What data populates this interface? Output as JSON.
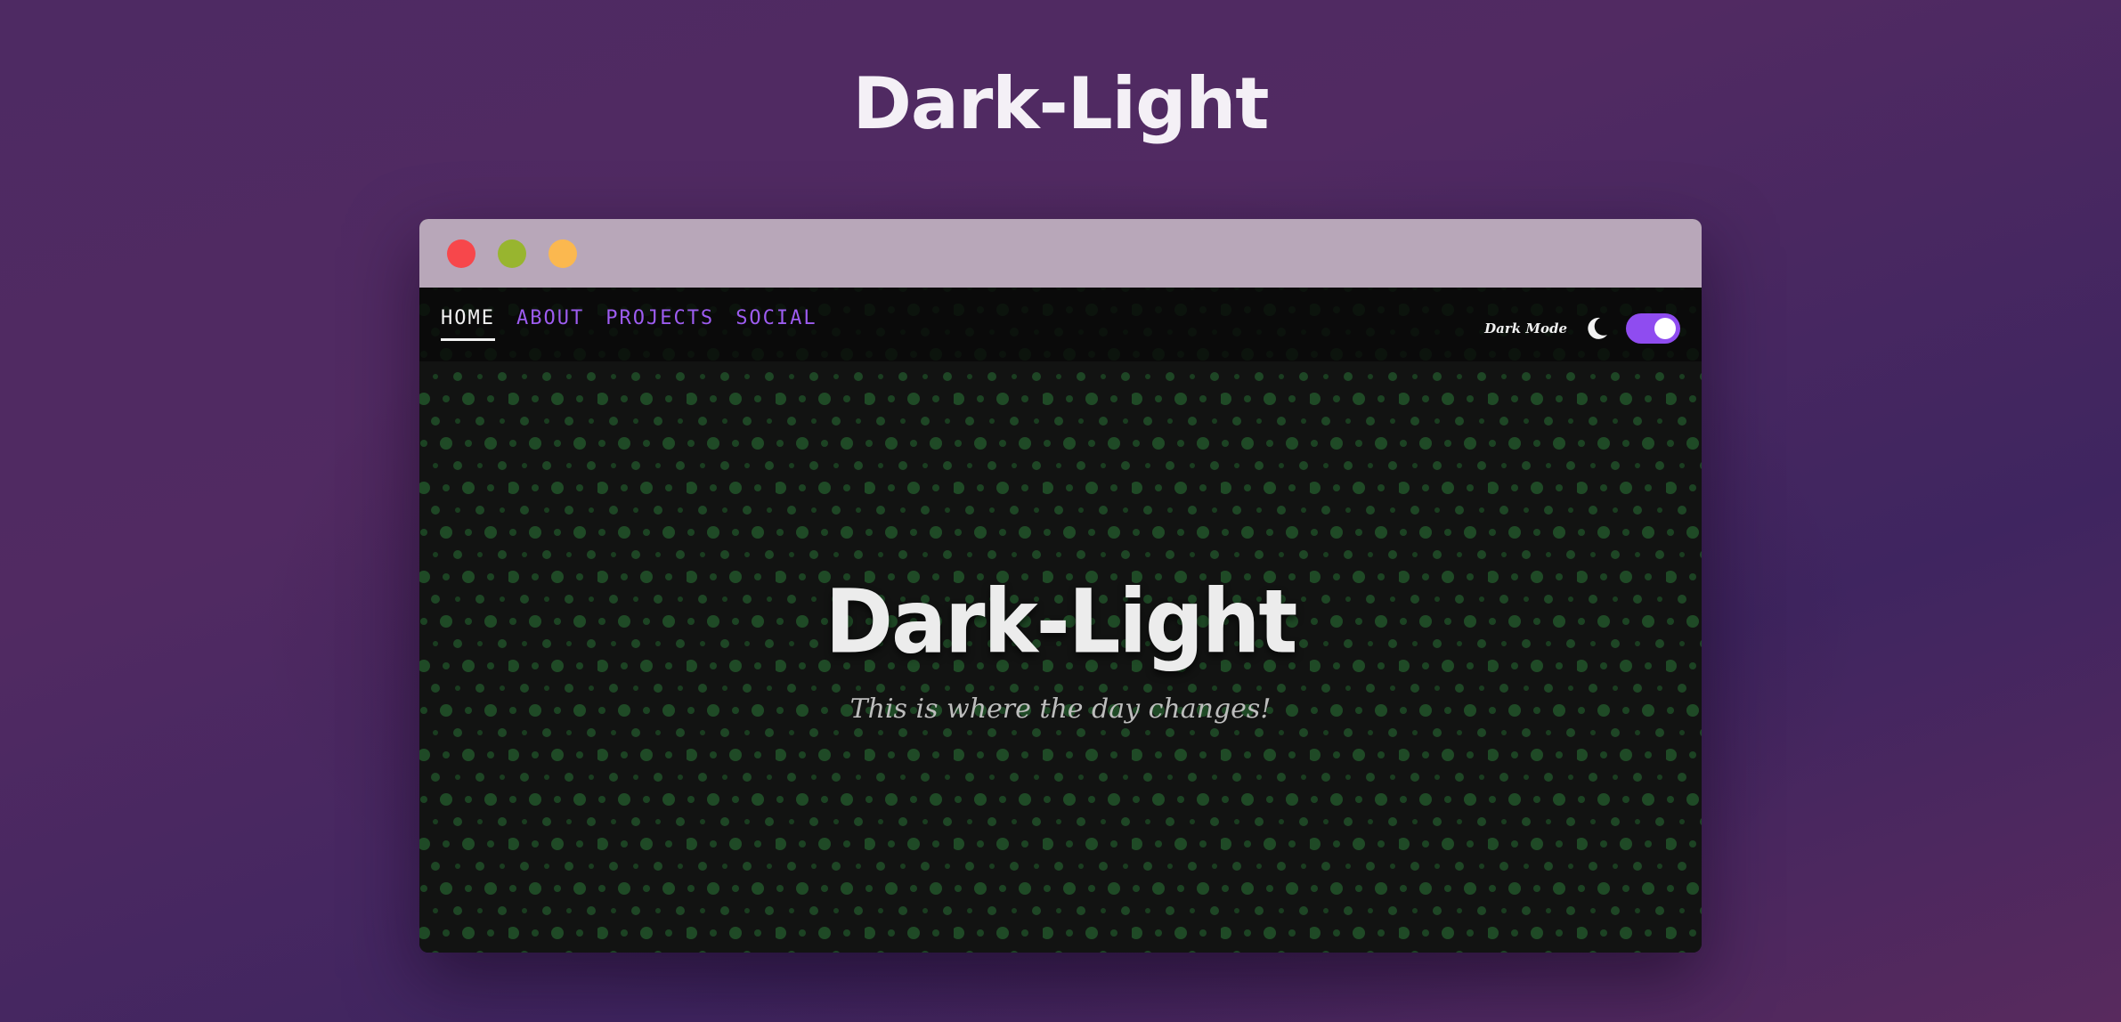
{
  "page": {
    "title": "Dark-Light"
  },
  "window": {
    "controls": [
      {
        "name": "close",
        "color": "#f7474b"
      },
      {
        "name": "minimize",
        "color": "#98b52f"
      },
      {
        "name": "maximize",
        "color": "#fbb84f"
      }
    ]
  },
  "nav": {
    "links": [
      "HOME",
      "ABOUT",
      "PROJECTS",
      "SOCIAL"
    ],
    "active": "HOME",
    "mode_label": "Dark Mode",
    "toggle_on": true,
    "accent_color": "#8f4cf0"
  },
  "hero": {
    "title": "Dark-Light",
    "subtitle": "This is where the day changes!"
  },
  "colors": {
    "background_dark": "#121312",
    "pattern_dots": "#1f4a26"
  }
}
